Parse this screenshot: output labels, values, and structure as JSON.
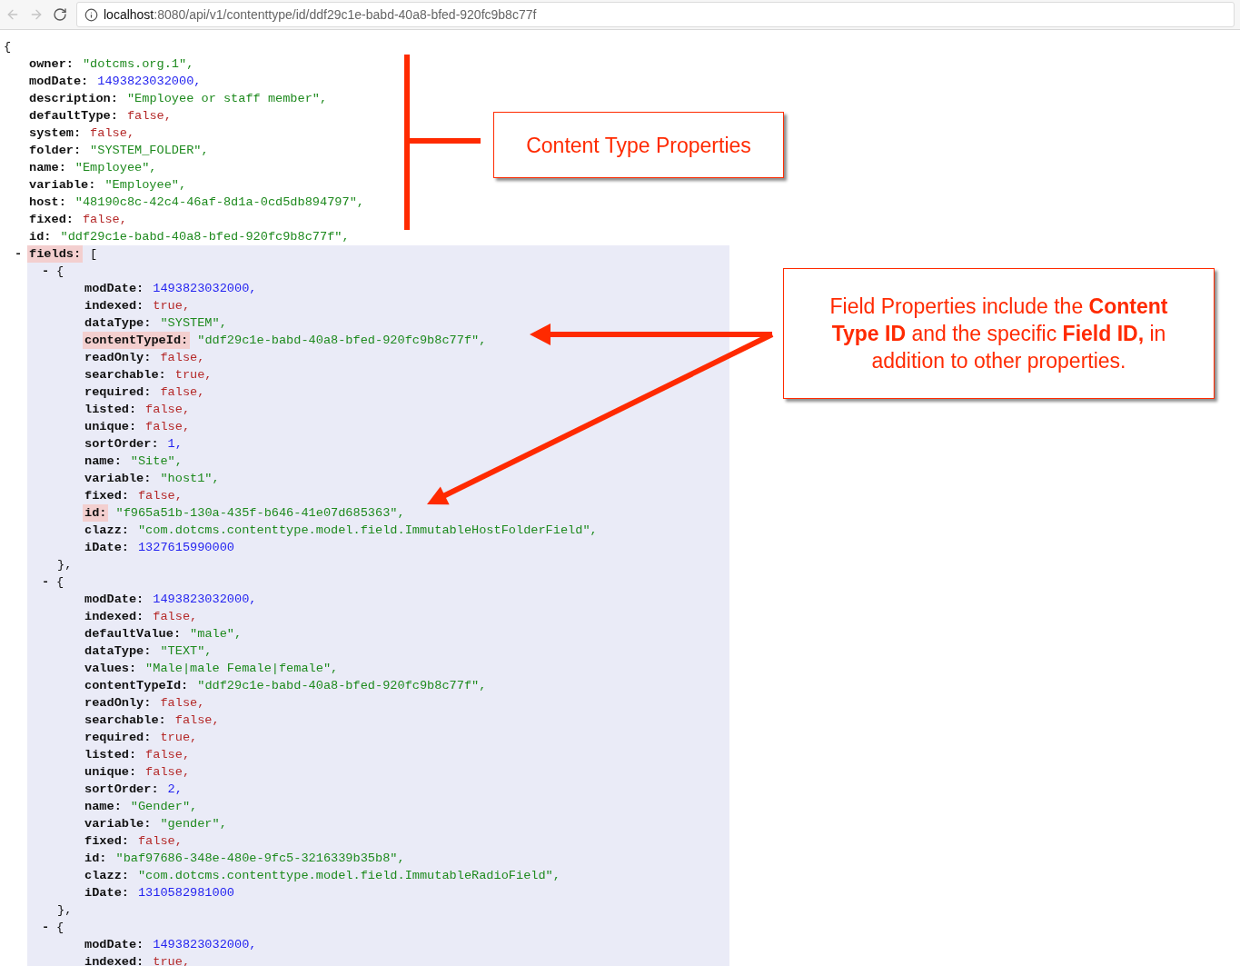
{
  "address_bar": {
    "host": "localhost",
    "path": ":8080/api/v1/contenttype/id/ddf29c1e-babd-40a8-bfed-920fc9b8c77f"
  },
  "json_view": {
    "open": "{",
    "properties": [
      {
        "key": "owner:",
        "value": "\"dotcms.org.1\",",
        "kind": "string",
        "highlighted": false
      },
      {
        "key": "modDate:",
        "value": "1493823032000,",
        "kind": "number",
        "highlighted": false
      },
      {
        "key": "description:",
        "value": "\"Employee or staff member\",",
        "kind": "string",
        "highlighted": false
      },
      {
        "key": "defaultType:",
        "value": "false,",
        "kind": "bool",
        "highlighted": false
      },
      {
        "key": "system:",
        "value": "false,",
        "kind": "bool",
        "highlighted": false
      },
      {
        "key": "folder:",
        "value": "\"SYSTEM_FOLDER\",",
        "kind": "string",
        "highlighted": false
      },
      {
        "key": "name:",
        "value": "\"Employee\",",
        "kind": "string",
        "highlighted": false
      },
      {
        "key": "variable:",
        "value": "\"Employee\",",
        "kind": "string",
        "highlighted": false
      },
      {
        "key": "host:",
        "value": "\"48190c8c-42c4-46af-8d1a-0cd5db894797\",",
        "kind": "string",
        "highlighted": false
      },
      {
        "key": "fixed:",
        "value": "false,",
        "kind": "bool",
        "highlighted": false
      },
      {
        "key": "id:",
        "value": "\"ddf29c1e-babd-40a8-bfed-920fc9b8c77f\",",
        "kind": "string",
        "highlighted": false
      }
    ],
    "fields": {
      "toggle": "-",
      "key": "fields:",
      "open": "[",
      "highlighted": true,
      "items": [
        {
          "toggle": "-",
          "open": "{",
          "close": "},",
          "properties": [
            {
              "key": "modDate:",
              "value": "1493823032000,",
              "kind": "number",
              "highlighted": false
            },
            {
              "key": "indexed:",
              "value": "true,",
              "kind": "bool",
              "highlighted": false
            },
            {
              "key": "dataType:",
              "value": "\"SYSTEM\",",
              "kind": "string",
              "highlighted": false
            },
            {
              "key": "contentTypeId:",
              "value": "\"ddf29c1e-babd-40a8-bfed-920fc9b8c77f\",",
              "kind": "string",
              "highlighted": true
            },
            {
              "key": "readOnly:",
              "value": "false,",
              "kind": "bool",
              "highlighted": false
            },
            {
              "key": "searchable:",
              "value": "true,",
              "kind": "bool",
              "highlighted": false
            },
            {
              "key": "required:",
              "value": "false,",
              "kind": "bool",
              "highlighted": false
            },
            {
              "key": "listed:",
              "value": "false,",
              "kind": "bool",
              "highlighted": false
            },
            {
              "key": "unique:",
              "value": "false,",
              "kind": "bool",
              "highlighted": false
            },
            {
              "key": "sortOrder:",
              "value": "1,",
              "kind": "number",
              "highlighted": false
            },
            {
              "key": "name:",
              "value": "\"Site\",",
              "kind": "string",
              "highlighted": false
            },
            {
              "key": "variable:",
              "value": "\"host1\",",
              "kind": "string",
              "highlighted": false
            },
            {
              "key": "fixed:",
              "value": "false,",
              "kind": "bool",
              "highlighted": false
            },
            {
              "key": "id:",
              "value": "\"f965a51b-130a-435f-b646-41e07d685363\",",
              "kind": "string",
              "highlighted": true
            },
            {
              "key": "clazz:",
              "value": "\"com.dotcms.contenttype.model.field.ImmutableHostFolderField\",",
              "kind": "string",
              "highlighted": false
            },
            {
              "key": "iDate:",
              "value": "1327615990000",
              "kind": "number",
              "highlighted": false
            }
          ]
        },
        {
          "toggle": "-",
          "open": "{",
          "close": "},",
          "properties": [
            {
              "key": "modDate:",
              "value": "1493823032000,",
              "kind": "number",
              "highlighted": false
            },
            {
              "key": "indexed:",
              "value": "false,",
              "kind": "bool",
              "highlighted": false
            },
            {
              "key": "defaultValue:",
              "value": "\"male\",",
              "kind": "string",
              "highlighted": false
            },
            {
              "key": "dataType:",
              "value": "\"TEXT\",",
              "kind": "string",
              "highlighted": false
            },
            {
              "key": "values:",
              "value": "\"Male|male Female|female\",",
              "kind": "string",
              "highlighted": false
            },
            {
              "key": "contentTypeId:",
              "value": "\"ddf29c1e-babd-40a8-bfed-920fc9b8c77f\",",
              "kind": "string",
              "highlighted": false
            },
            {
              "key": "readOnly:",
              "value": "false,",
              "kind": "bool",
              "highlighted": false
            },
            {
              "key": "searchable:",
              "value": "false,",
              "kind": "bool",
              "highlighted": false
            },
            {
              "key": "required:",
              "value": "true,",
              "kind": "bool",
              "highlighted": false
            },
            {
              "key": "listed:",
              "value": "false,",
              "kind": "bool",
              "highlighted": false
            },
            {
              "key": "unique:",
              "value": "false,",
              "kind": "bool",
              "highlighted": false
            },
            {
              "key": "sortOrder:",
              "value": "2,",
              "kind": "number",
              "highlighted": false
            },
            {
              "key": "name:",
              "value": "\"Gender\",",
              "kind": "string",
              "highlighted": false
            },
            {
              "key": "variable:",
              "value": "\"gender\",",
              "kind": "string",
              "highlighted": false
            },
            {
              "key": "fixed:",
              "value": "false,",
              "kind": "bool",
              "highlighted": false
            },
            {
              "key": "id:",
              "value": "\"baf97686-348e-480e-9fc5-3216339b35b8\",",
              "kind": "string",
              "highlighted": false
            },
            {
              "key": "clazz:",
              "value": "\"com.dotcms.contenttype.model.field.ImmutableRadioField\",",
              "kind": "string",
              "highlighted": false
            },
            {
              "key": "iDate:",
              "value": "1310582981000",
              "kind": "number",
              "highlighted": false
            }
          ]
        },
        {
          "toggle": "-",
          "open": "{",
          "properties": [
            {
              "key": "modDate:",
              "value": "1493823032000,",
              "kind": "number",
              "highlighted": false
            },
            {
              "key": "indexed:",
              "value": "true,",
              "kind": "bool",
              "highlighted": false
            }
          ]
        }
      ]
    }
  },
  "annotations": [
    {
      "text": "Content Type Properties"
    },
    {
      "text": "Field Properties include the **Content Type ID** and the specific **Field ID,** in addition to other properties."
    }
  ]
}
